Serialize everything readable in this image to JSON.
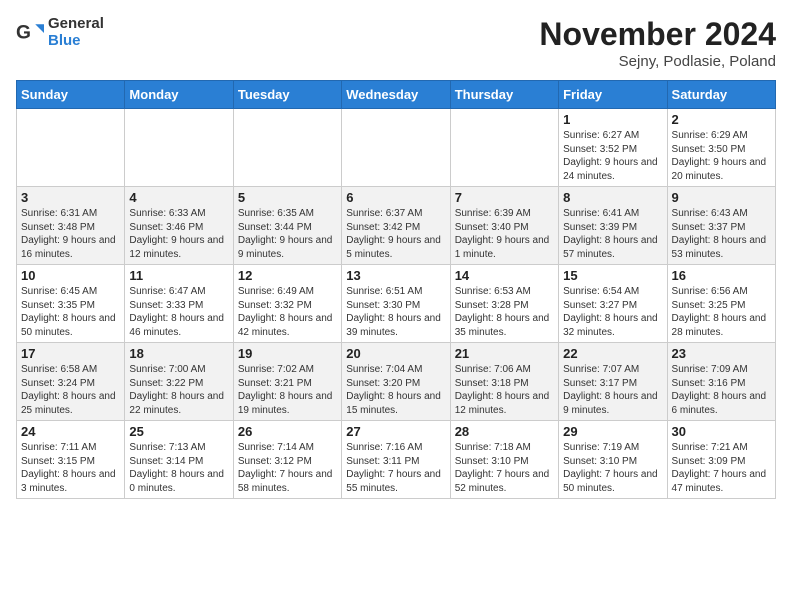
{
  "header": {
    "logo": {
      "line1": "General",
      "line2": "Blue"
    },
    "title": "November 2024",
    "subtitle": "Sejny, Podlasie, Poland"
  },
  "weekdays": [
    "Sunday",
    "Monday",
    "Tuesday",
    "Wednesday",
    "Thursday",
    "Friday",
    "Saturday"
  ],
  "weeks": [
    [
      {
        "day": "",
        "detail": ""
      },
      {
        "day": "",
        "detail": ""
      },
      {
        "day": "",
        "detail": ""
      },
      {
        "day": "",
        "detail": ""
      },
      {
        "day": "",
        "detail": ""
      },
      {
        "day": "1",
        "detail": "Sunrise: 6:27 AM\nSunset: 3:52 PM\nDaylight: 9 hours\nand 24 minutes."
      },
      {
        "day": "2",
        "detail": "Sunrise: 6:29 AM\nSunset: 3:50 PM\nDaylight: 9 hours\nand 20 minutes."
      }
    ],
    [
      {
        "day": "3",
        "detail": "Sunrise: 6:31 AM\nSunset: 3:48 PM\nDaylight: 9 hours\nand 16 minutes."
      },
      {
        "day": "4",
        "detail": "Sunrise: 6:33 AM\nSunset: 3:46 PM\nDaylight: 9 hours\nand 12 minutes."
      },
      {
        "day": "5",
        "detail": "Sunrise: 6:35 AM\nSunset: 3:44 PM\nDaylight: 9 hours\nand 9 minutes."
      },
      {
        "day": "6",
        "detail": "Sunrise: 6:37 AM\nSunset: 3:42 PM\nDaylight: 9 hours\nand 5 minutes."
      },
      {
        "day": "7",
        "detail": "Sunrise: 6:39 AM\nSunset: 3:40 PM\nDaylight: 9 hours\nand 1 minute."
      },
      {
        "day": "8",
        "detail": "Sunrise: 6:41 AM\nSunset: 3:39 PM\nDaylight: 8 hours\nand 57 minutes."
      },
      {
        "day": "9",
        "detail": "Sunrise: 6:43 AM\nSunset: 3:37 PM\nDaylight: 8 hours\nand 53 minutes."
      }
    ],
    [
      {
        "day": "10",
        "detail": "Sunrise: 6:45 AM\nSunset: 3:35 PM\nDaylight: 8 hours\nand 50 minutes."
      },
      {
        "day": "11",
        "detail": "Sunrise: 6:47 AM\nSunset: 3:33 PM\nDaylight: 8 hours\nand 46 minutes."
      },
      {
        "day": "12",
        "detail": "Sunrise: 6:49 AM\nSunset: 3:32 PM\nDaylight: 8 hours\nand 42 minutes."
      },
      {
        "day": "13",
        "detail": "Sunrise: 6:51 AM\nSunset: 3:30 PM\nDaylight: 8 hours\nand 39 minutes."
      },
      {
        "day": "14",
        "detail": "Sunrise: 6:53 AM\nSunset: 3:28 PM\nDaylight: 8 hours\nand 35 minutes."
      },
      {
        "day": "15",
        "detail": "Sunrise: 6:54 AM\nSunset: 3:27 PM\nDaylight: 8 hours\nand 32 minutes."
      },
      {
        "day": "16",
        "detail": "Sunrise: 6:56 AM\nSunset: 3:25 PM\nDaylight: 8 hours\nand 28 minutes."
      }
    ],
    [
      {
        "day": "17",
        "detail": "Sunrise: 6:58 AM\nSunset: 3:24 PM\nDaylight: 8 hours\nand 25 minutes."
      },
      {
        "day": "18",
        "detail": "Sunrise: 7:00 AM\nSunset: 3:22 PM\nDaylight: 8 hours\nand 22 minutes."
      },
      {
        "day": "19",
        "detail": "Sunrise: 7:02 AM\nSunset: 3:21 PM\nDaylight: 8 hours\nand 19 minutes."
      },
      {
        "day": "20",
        "detail": "Sunrise: 7:04 AM\nSunset: 3:20 PM\nDaylight: 8 hours\nand 15 minutes."
      },
      {
        "day": "21",
        "detail": "Sunrise: 7:06 AM\nSunset: 3:18 PM\nDaylight: 8 hours\nand 12 minutes."
      },
      {
        "day": "22",
        "detail": "Sunrise: 7:07 AM\nSunset: 3:17 PM\nDaylight: 8 hours\nand 9 minutes."
      },
      {
        "day": "23",
        "detail": "Sunrise: 7:09 AM\nSunset: 3:16 PM\nDaylight: 8 hours\nand 6 minutes."
      }
    ],
    [
      {
        "day": "24",
        "detail": "Sunrise: 7:11 AM\nSunset: 3:15 PM\nDaylight: 8 hours\nand 3 minutes."
      },
      {
        "day": "25",
        "detail": "Sunrise: 7:13 AM\nSunset: 3:14 PM\nDaylight: 8 hours\nand 0 minutes."
      },
      {
        "day": "26",
        "detail": "Sunrise: 7:14 AM\nSunset: 3:12 PM\nDaylight: 7 hours\nand 58 minutes."
      },
      {
        "day": "27",
        "detail": "Sunrise: 7:16 AM\nSunset: 3:11 PM\nDaylight: 7 hours\nand 55 minutes."
      },
      {
        "day": "28",
        "detail": "Sunrise: 7:18 AM\nSunset: 3:10 PM\nDaylight: 7 hours\nand 52 minutes."
      },
      {
        "day": "29",
        "detail": "Sunrise: 7:19 AM\nSunset: 3:10 PM\nDaylight: 7 hours\nand 50 minutes."
      },
      {
        "day": "30",
        "detail": "Sunrise: 7:21 AM\nSunset: 3:09 PM\nDaylight: 7 hours\nand 47 minutes."
      }
    ]
  ]
}
